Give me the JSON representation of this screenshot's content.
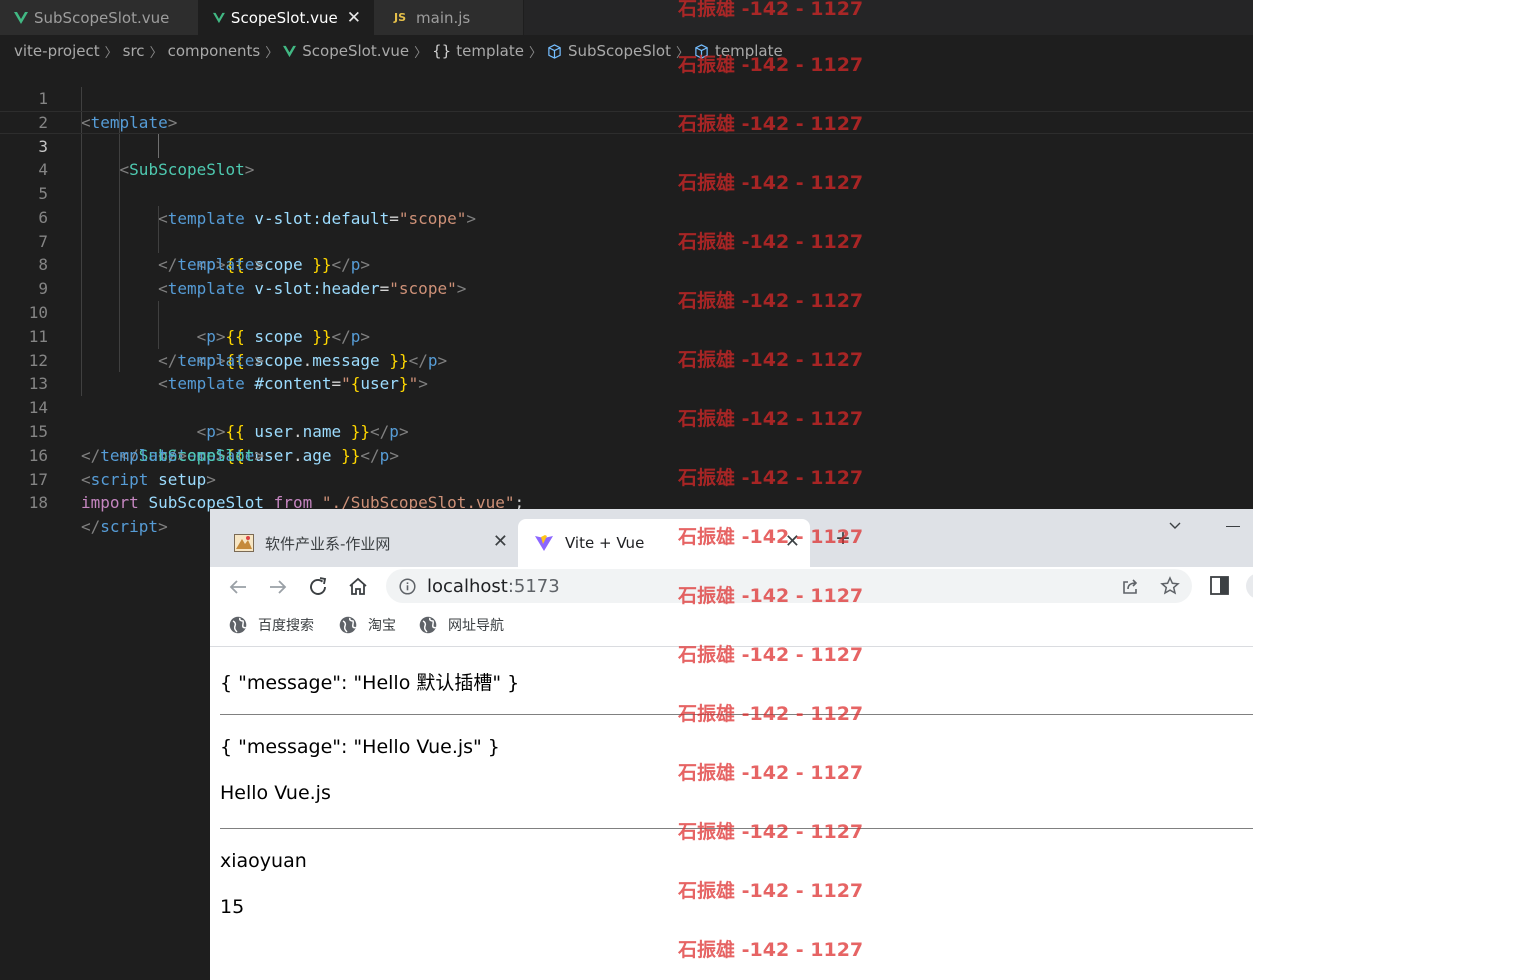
{
  "editor": {
    "tabs": [
      {
        "label": "SubScopeSlot.vue",
        "active": false,
        "icon": "vue-icon"
      },
      {
        "label": "ScopeSlot.vue",
        "active": true,
        "icon": "vue-icon",
        "close": "✕"
      },
      {
        "label": "main.js",
        "active": false,
        "icon": "js-icon",
        "badge": "JS"
      }
    ],
    "breadcrumb": [
      "vite-project",
      "src",
      "components",
      "ScopeSlot.vue",
      "template",
      "SubScopeSlot",
      "template"
    ],
    "breadcrumb_braces": "{}",
    "line_numbers": [
      "1",
      "2",
      "3",
      "4",
      "5",
      "6",
      "7",
      "8",
      "9",
      "10",
      "11",
      "12",
      "13",
      "14",
      "15",
      "16",
      "17",
      "18"
    ],
    "current_line": 3
  },
  "browser": {
    "tabs": [
      {
        "title": "软件产业系-作业网",
        "close": "✕"
      },
      {
        "title": "Vite + Vue",
        "close": "✕",
        "active": true
      }
    ],
    "new_tab": "+",
    "url_host": "localhost",
    "url_port": ":5173",
    "bookmarks": [
      "百度搜索",
      "淘宝",
      "网址导航"
    ],
    "page": {
      "default_slot": "{ \"message\": \"Hello 默认插槽\" }",
      "header_scope": "{ \"message\": \"Hello Vue.js\" }",
      "header_message": "Hello Vue.js",
      "user_name": "xiaoyuan",
      "user_age": "15"
    }
  },
  "watermark": "石振雄 -142 - 1127",
  "colors": {
    "editor_bg": "#1e1e1e",
    "tag": "#569cd6",
    "component": "#4ec9b0",
    "attribute": "#9cdcfe",
    "string": "#ce9178",
    "mustache": "#ffd700",
    "keyword": "#c586c0",
    "watermark": "#dc2828"
  }
}
